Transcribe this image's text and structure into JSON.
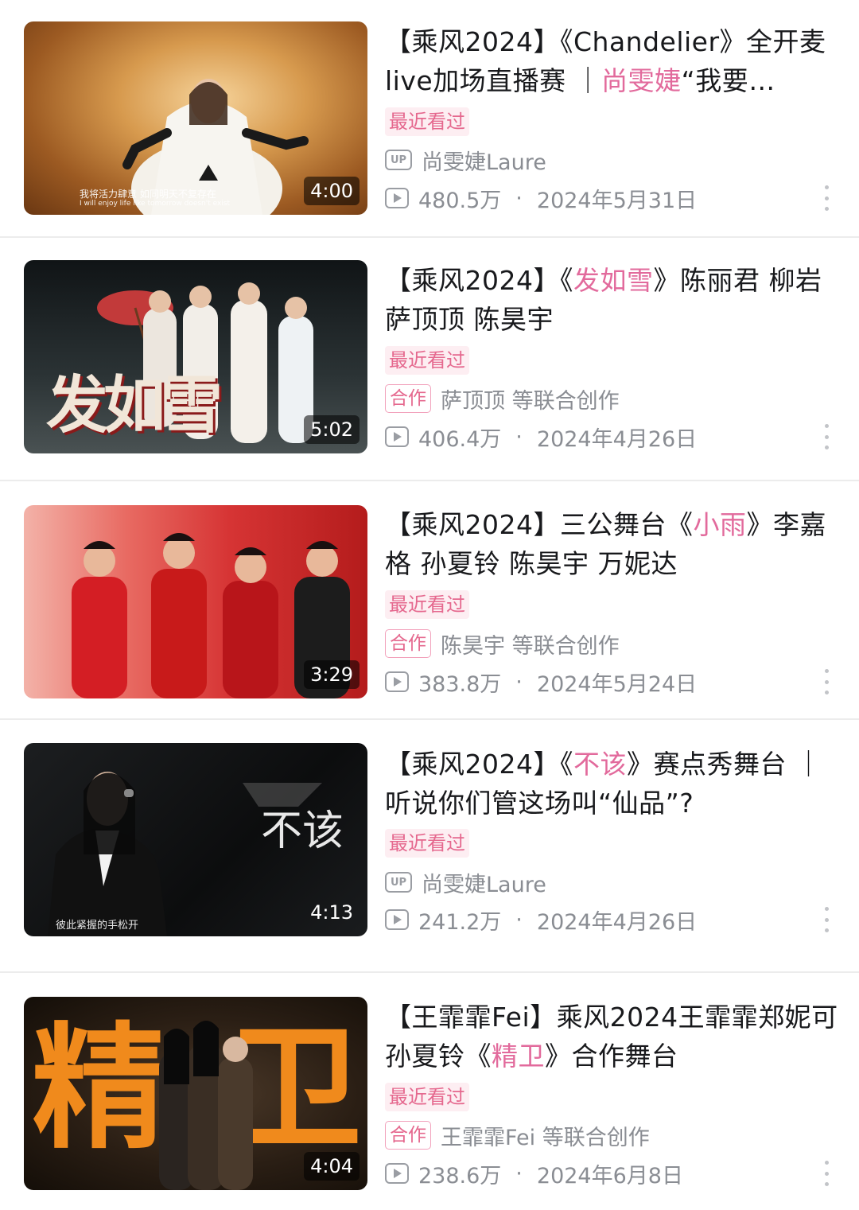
{
  "videos": [
    {
      "title_parts": [
        "【乘风2024】《Chandelier》全开麦live加场直播赛 ｜",
        "尚雯婕",
        "“我要…"
      ],
      "recent": "最近看过",
      "author_type": "up",
      "author_badge": "UP",
      "author": "尚雯婕Laure",
      "views": "480.5万",
      "date": "2024年5月31日",
      "duration": "4:00",
      "thumb_caption_1": "我将活力肆意  如同明天不复存在",
      "thumb_caption_2": "I will enjoy life like tomorrow doesn't exist",
      "thumb_colors": [
        "#c88a3c",
        "#8a4b1c",
        "#f3c98a"
      ]
    },
    {
      "title_parts": [
        "【乘风2024】《",
        "发如雪",
        "》陈丽君 柳岩 萨顶顶 陈昊宇"
      ],
      "recent": "最近看过",
      "author_type": "collab",
      "author_badge": "合作",
      "author": "萨顶顶 等联合创作",
      "views": "406.4万",
      "date": "2024年4月26日",
      "duration": "5:02",
      "thumb_text": "发如雪",
      "thumb_colors": [
        "#1c2022",
        "#3a4446",
        "#d9dcd8"
      ]
    },
    {
      "title_parts": [
        "【乘风2024】三公舞台《",
        "小雨",
        "》李嘉格 孙夏铃 陈昊宇 万妮达"
      ],
      "recent": "最近看过",
      "author_type": "collab",
      "author_badge": "合作",
      "author": "陈昊宇 等联合创作",
      "views": "383.8万",
      "date": "2024年5月24日",
      "duration": "3:29",
      "thumb_colors": [
        "#d83a3a",
        "#f4a8a0",
        "#8c1414"
      ]
    },
    {
      "title_parts": [
        "【乘风2024】《",
        "不该",
        "》赛点秀舞台 ｜听说你们管这场叫“仙品”?"
      ],
      "recent": "最近看过",
      "author_type": "up",
      "author_badge": "UP",
      "author": "尚雯婕Laure",
      "views": "241.2万",
      "date": "2024年4月26日",
      "duration": "4:13",
      "thumb_text": "不该",
      "thumb_caption_1": "彼此紧握的手松开",
      "thumb_colors": [
        "#0e0f10",
        "#2a2c2e",
        "#e8e8e8"
      ]
    },
    {
      "title_parts": [
        "【王霏霏Fei】乘风2024王霏霏郑妮可孙夏铃《",
        "精卫",
        "》合作舞台"
      ],
      "recent": "最近看过",
      "author_type": "collab",
      "author_badge": "合作",
      "author": "王霏霏Fei 等联合创作",
      "views": "238.6万",
      "date": "2024年6月8日",
      "duration": "4:04",
      "thumb_text_left": "精",
      "thumb_text_right": "卫",
      "thumb_colors": [
        "#1a1410",
        "#3a2a1e",
        "#f08a1c"
      ]
    }
  ],
  "icons": {
    "play": "play-count-icon",
    "more": "more-vertical-icon",
    "up": "up-badge-icon"
  },
  "colors": {
    "highlight": "#e26a9c",
    "recent_bg": "#fdeef2",
    "recent_text": "#e5688e",
    "meta": "#8a8d93"
  }
}
